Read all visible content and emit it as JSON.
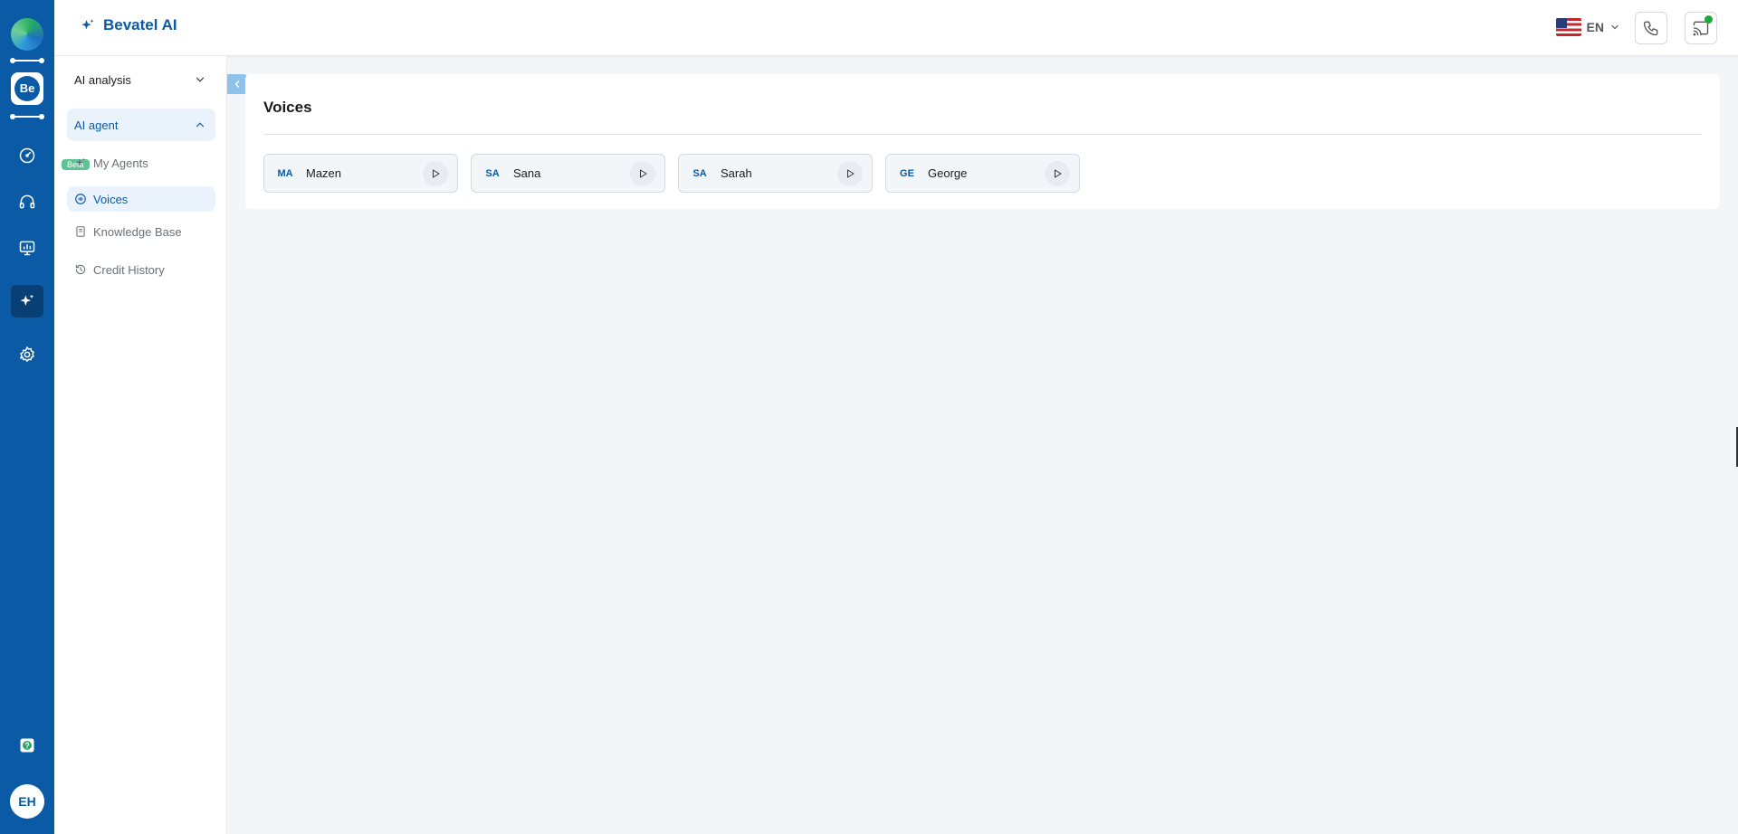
{
  "app": {
    "brand": "Bevatel AI"
  },
  "rail": {
    "workspace_badge": "Be",
    "avatar_initials": "EH"
  },
  "header": {
    "language": "EN"
  },
  "sidebar": {
    "groups": [
      {
        "label": "AI analysis",
        "expanded": false
      },
      {
        "label": "AI agent",
        "expanded": true,
        "badge": "Beta"
      }
    ],
    "items": [
      {
        "label": "My Agents",
        "icon": "sparkle-icon"
      },
      {
        "label": "Voices",
        "icon": "voice-icon",
        "active": true
      },
      {
        "label": "Knowledge Base",
        "icon": "book-icon"
      },
      {
        "label": "Credit History",
        "icon": "history-icon"
      }
    ]
  },
  "main": {
    "title": "Voices",
    "voices": [
      {
        "abbr": "MA",
        "name": "Mazen"
      },
      {
        "abbr": "SA",
        "name": "Sana"
      },
      {
        "abbr": "SA",
        "name": "Sarah"
      },
      {
        "abbr": "GE",
        "name": "George"
      }
    ]
  },
  "colors": {
    "primary": "#0b5aa5",
    "active_bg": "#eaf3fc",
    "beta": "#5ec394",
    "online": "#1fa83a"
  }
}
